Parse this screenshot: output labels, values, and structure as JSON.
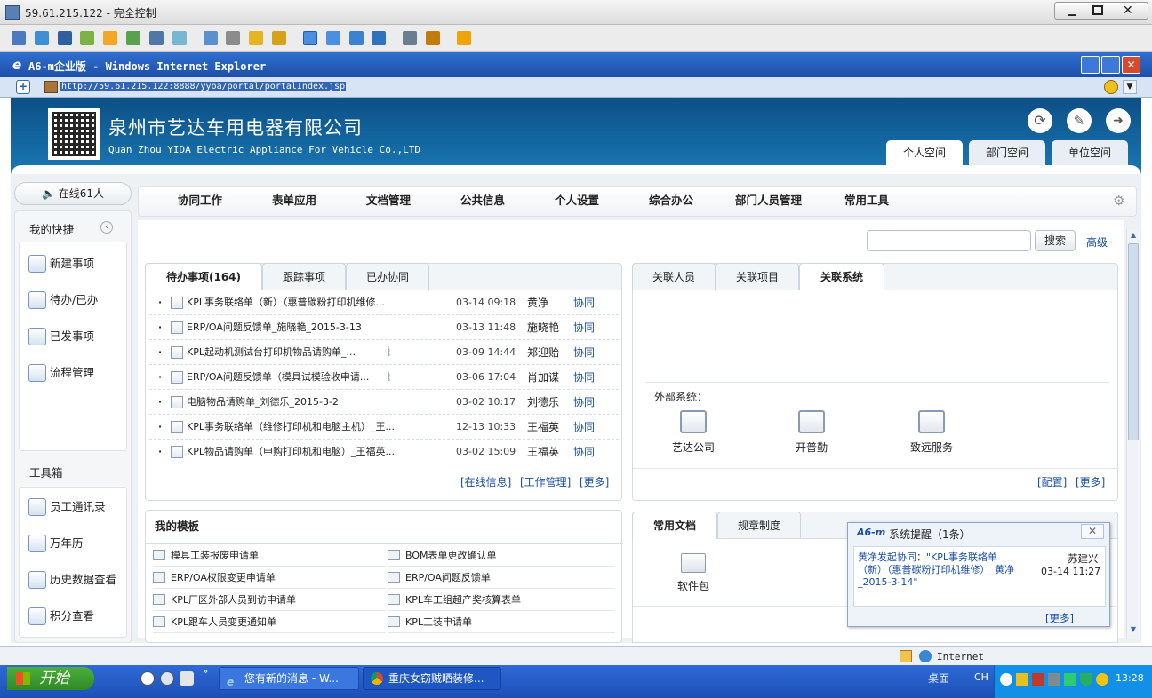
{
  "remote": {
    "title": "59.61.215.122 - 完全控制"
  },
  "ie": {
    "title": "A6-m企业版 - Windows Internet Explorer",
    "url": "http://59.61.215.122:8888/yyoa/portal/portalIndex.jsp"
  },
  "header": {
    "company_cn": "泉州市艺达车用电器有限公司",
    "company_en": "Quan Zhou YIDA Electric Appliance For Vehicle Co.,LTD",
    "spaces": [
      "个人空间",
      "部门空间",
      "单位空间"
    ]
  },
  "nav": [
    "协同工作",
    "表单应用",
    "文档管理",
    "公共信息",
    "个人设置",
    "综合办公",
    "部门人员管理",
    "常用工具"
  ],
  "online": "在线61人",
  "sidebar": {
    "shortcuts_title": "我的快捷",
    "shortcuts": [
      "新建事项",
      "待办/已办",
      "已发事项",
      "流程管理"
    ],
    "toolbox_title": "工具箱",
    "tools": [
      "员工通讯录",
      "万年历",
      "历史数据查看",
      "积分查看"
    ]
  },
  "search": {
    "button": "搜索",
    "advanced": "高级",
    "placeholder": ""
  },
  "pending": {
    "tabs": [
      "待办事项(164)",
      "跟踪事项",
      "已办协同"
    ],
    "rows": [
      {
        "title": "KPL事务联络单（新）（惠普碳粉打印机维修...",
        "date": "03-14 09:18",
        "user": "黄净",
        "type": "协同",
        "attach": false
      },
      {
        "title": "ERP/OA问题反馈单_施晓艳_2015-3-13",
        "date": "03-13 11:48",
        "user": "施晓艳",
        "type": "协同",
        "attach": false
      },
      {
        "title": "KPL起动机测试台打印机物品请购单_...",
        "date": "03-09 14:44",
        "user": "郑迎贻",
        "type": "协同",
        "attach": true
      },
      {
        "title": "ERP/OA问题反馈单（模具试模验收申请...",
        "date": "03-06 17:04",
        "user": "肖加谋",
        "type": "协同",
        "attach": true
      },
      {
        "title": "电脑物品请购单_刘德乐_2015-3-2",
        "date": "03-02 10:17",
        "user": "刘德乐",
        "type": "协同",
        "attach": false
      },
      {
        "title": "KPL事务联络单（维修打印机和电脑主机）_王...",
        "date": "12-13 10:33",
        "user": "王福英",
        "type": "协同",
        "attach": false
      },
      {
        "title": "KPL物品请购单（申购打印机和电脑）_王福英...",
        "date": "03-02 15:09",
        "user": "王福英",
        "type": "协同",
        "attach": false
      }
    ],
    "footer": [
      "[在线信息]",
      "[工作管理]",
      "[更多]"
    ]
  },
  "related": {
    "tabs": [
      "关联人员",
      "关联项目",
      "关联系统"
    ],
    "external_label": "外部系统：",
    "systems": [
      "艺达公司",
      "开普勤",
      "致远服务"
    ],
    "footer": [
      "[配置]",
      "[更多]"
    ]
  },
  "templates": {
    "title": "我的模板",
    "items": [
      "模具工装报废申请单",
      "BOM表单更改确认单",
      "ERP/OA权限变更申请单",
      "ERP/OA问题反馈单",
      "KPL厂区外部人员到访申请单",
      "KPL车工组超产奖核算表单",
      "KPL跟车人员变更通知单",
      "KPL工装申请单"
    ]
  },
  "docs": {
    "tabs": [
      "常用文档",
      "规章制度"
    ],
    "folder": "软件包"
  },
  "popup": {
    "title": "系统提醒（1条）",
    "logo": "A6-m",
    "message": "黄净发起协同：\"KPL事务联络单（新）（惠普碳粉打印机维修）_黄净_2015-3-14\"",
    "sender": "苏建兴",
    "time": "03-14 11:27",
    "more": "[更多]"
  },
  "status": {
    "zone": "Internet"
  },
  "taskbar": {
    "start": "开始",
    "tasks": [
      "您有新的消息 - W...",
      "重庆女窃贼晒装修..."
    ],
    "desktop": "桌面",
    "lang": "CH",
    "clock": "13:28"
  }
}
